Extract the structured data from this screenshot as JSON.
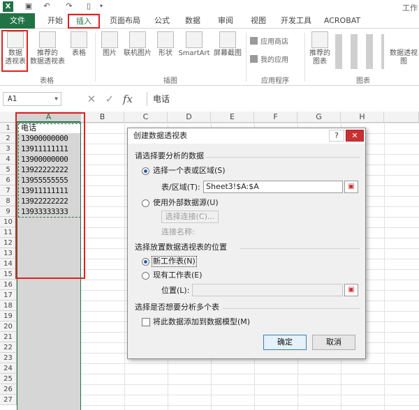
{
  "titlebar": {
    "window_title": "工作",
    "qa_icons": [
      "save-icon",
      "undo-icon",
      "redo-icon",
      "new-file-icon"
    ]
  },
  "tabs": [
    "文件",
    "开始",
    "插入",
    "页面布局",
    "公式",
    "数据",
    "审阅",
    "视图",
    "开发工具",
    "ACROBAT"
  ],
  "ribbon": {
    "groups": {
      "tables": "表格",
      "illustrations": "插图",
      "apps": "应用程序",
      "charts": "图表"
    },
    "buttons": {
      "pivot_line1": "数据",
      "pivot_line2": "透视表",
      "recommended_pivot_line1": "推荐的",
      "recommended_pivot_line2": "数据透视表",
      "table": "表格",
      "picture": "图片",
      "online_picture": "联机图片",
      "shapes": "形状",
      "smartart": "SmartArt",
      "screenshot": "屏幕截图",
      "app_store": "应用商店",
      "my_apps": "我的应用",
      "recommended_chart_line1": "推荐的",
      "recommended_chart_line2": "图表",
      "pivot_chart": "数据透视图"
    }
  },
  "formula_bar": {
    "name_box": "A1",
    "cancel": "✕",
    "enter": "✓",
    "fx": "fx",
    "content": "电话"
  },
  "sheet": {
    "columns": [
      "A",
      "B",
      "C",
      "D",
      "E",
      "F",
      "G",
      "H"
    ],
    "rows": [
      "1",
      "2",
      "3",
      "4",
      "5",
      "6",
      "7",
      "8",
      "9",
      "10",
      "11",
      "12",
      "13",
      "14",
      "15",
      "16",
      "17",
      "18",
      "19",
      "20",
      "21",
      "22",
      "23",
      "24",
      "25",
      "26",
      "27"
    ],
    "colA_values": [
      "电话",
      "13900000000",
      "13911111111",
      "13900000000",
      "13922222222",
      "13955555555",
      "13911111111",
      "13922222222",
      "13933333333"
    ]
  },
  "dialog": {
    "title": "创建数据透视表",
    "help": "?",
    "close": "✕",
    "section1": "请选择要分析的数据",
    "opt_range": "选择一个表或区域(S)",
    "range_label": "表/区域(T):",
    "range_value": "Sheet3!$A:$A",
    "opt_external": "使用外部数据源(U)",
    "choose_conn": "选择连接(C)...",
    "conn_name": "连接名称:",
    "section2": "选择放置数据透视表的位置",
    "opt_new_sheet": "新工作表(N)",
    "opt_existing": "现有工作表(E)",
    "location_label": "位置(L):",
    "location_value": "",
    "section3": "选择是否想要分析多个表",
    "add_model": "将此数据添加到数据模型(M)",
    "ok": "确定",
    "cancel": "取消"
  }
}
